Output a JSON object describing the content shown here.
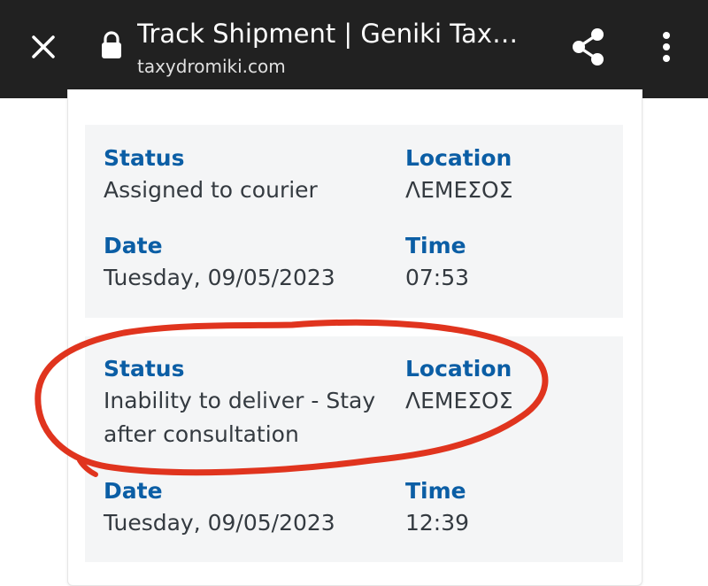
{
  "browser": {
    "title": "Track Shipment | Geniki Taxy…",
    "domain": "taxydromiki.com",
    "icons": {
      "close": "close-icon",
      "lock": "lock-icon",
      "share": "share-icon",
      "menu": "more-vert-icon"
    }
  },
  "events": [
    {
      "status_label": "Status",
      "status": "Assigned to courier",
      "location_label": "Location",
      "location": "ΛΕΜΕΣΟΣ",
      "date_label": "Date",
      "date": "Tuesday, 09/05/2023",
      "time_label": "Time",
      "time": "07:53"
    },
    {
      "status_label": "Status",
      "status_line1": "Inability to deliver - Stay",
      "status_line2": "after consultation",
      "location_label": "Location",
      "location": "ΛΕΜΕΣΟΣ",
      "date_label": "Date",
      "date": "Tuesday, 09/05/2023",
      "time_label": "Time",
      "time": "12:39"
    }
  ],
  "colors": {
    "topbar": "#212121",
    "label": "#0b5ea5",
    "text": "#343a40",
    "event_bg": "#f4f5f6",
    "annotation": "#e0341e"
  }
}
